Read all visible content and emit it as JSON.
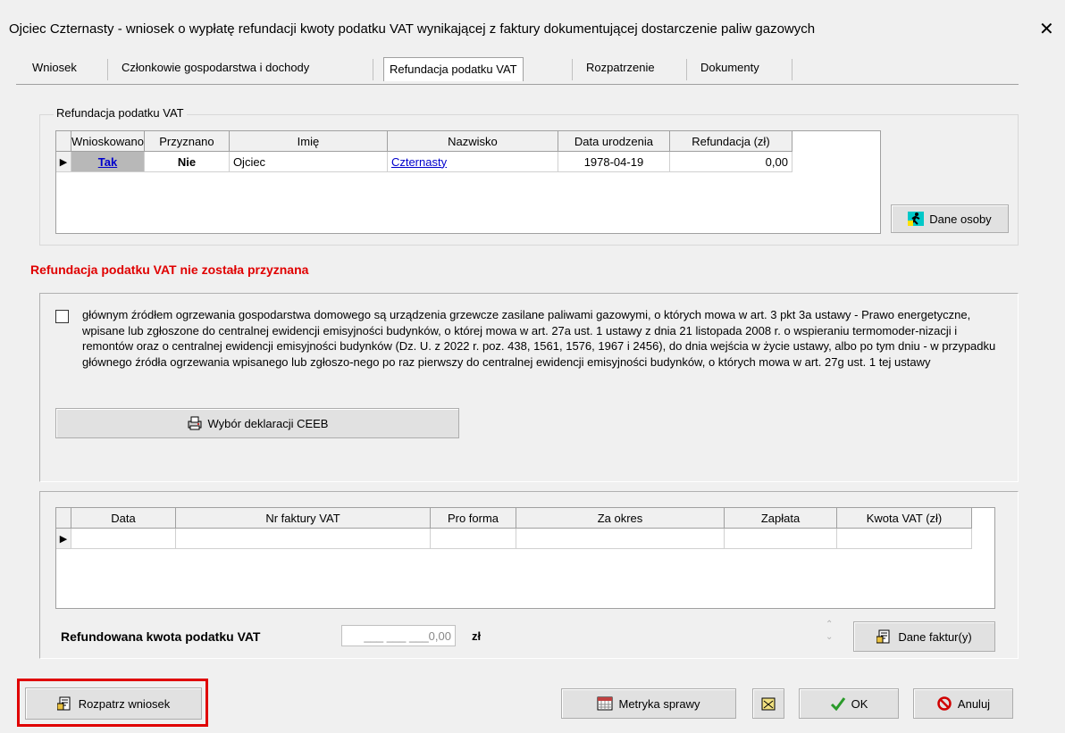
{
  "window": {
    "title": "Ojciec Czternasty - wniosek o wypłatę refundacji kwoty podatku VAT wynikającej z faktury dokumentującej dostarczenie paliw gazowych",
    "close": "✕"
  },
  "tabs": [
    {
      "label": "Wniosek"
    },
    {
      "label": "Członkowie gospodarstwa i dochody"
    },
    {
      "label": "Refundacja podatku VAT"
    },
    {
      "label": "Rozpatrzenie"
    },
    {
      "label": "Dokumenty"
    }
  ],
  "refund_group": {
    "legend": "Refundacja podatku VAT",
    "columns": [
      "Wnioskowano",
      "Przyznano",
      "Imię",
      "Nazwisko",
      "Data urodzenia",
      "Refundacja  (zł)"
    ],
    "row": {
      "wnioskowano": "Tak",
      "przyznano": "Nie",
      "imie": "Ojciec",
      "nazwisko": "Czternasty",
      "data_urodzenia": "1978-04-19",
      "refundacja": "0,00"
    },
    "dane_osoby": "Dane osoby"
  },
  "status_message": "Refundacja podatku VAT nie została przyznana",
  "ceeb": {
    "checkbox_text": "głównym źródłem ogrzewania gospodarstwa domowego są urządzenia grzewcze zasilane paliwami gazowymi, o których mowa w art. 3 pkt 3a ustawy - Prawo energetyczne, wpisane lub zgłoszone do centralnej ewidencji emisyjności budynków, o której mowa w art. 27a ust. 1 ustawy z dnia 21 listopada 2008 r. o wspieraniu termomoder-nizacji i remontów oraz o centralnej ewidencji emisyjności budynków (Dz. U. z 2022 r. poz. 438, 1561, 1576, 1967 i 2456), do dnia wejścia w życie ustawy, albo po tym dniu - w przypadku głównego źródła ogrzewania wpisanego lub zgłoszo-nego po raz pierwszy do centralnej ewidencji emisyjności budynków, o których mowa w art. 27g ust. 1 tej ustawy",
    "button": "Wybór deklaracji CEEB",
    "button_accel": "d"
  },
  "invoices": {
    "columns": [
      "Data",
      "Nr faktury VAT",
      "Pro forma",
      "Za okres",
      "Zapłata",
      "Kwota VAT  (zł)"
    ],
    "total_label": "Refundowana kwota podatku VAT",
    "total_value": "___ ___ ___0,00",
    "total_unit": "zł",
    "dane_faktury": "Dane faktur(y)"
  },
  "footer": {
    "rozpatrz": "Rozpatrz wniosek",
    "metryka": "Metryka sprawy",
    "ok": "OK",
    "anuluj": "Anuluj"
  },
  "colors": {
    "highlight_border": "#e00000",
    "link": "#0000cc",
    "error_text": "#e00000"
  }
}
